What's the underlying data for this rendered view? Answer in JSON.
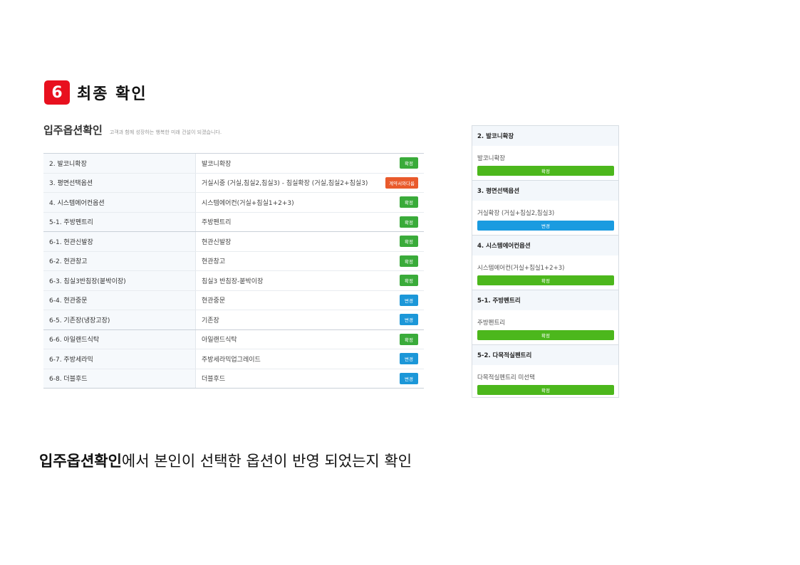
{
  "step": {
    "number": "6",
    "title": "최종 확인"
  },
  "option_panel": {
    "title": "입주옵션확인",
    "subtitle": "고객과 함께 성장하는 행복한 미래 건설이 되겠습니다.",
    "rows": [
      {
        "name": "2. 발코니확장",
        "value": "발코니확장",
        "status": "확정",
        "color": "green"
      },
      {
        "name": "3. 평면선택옵션",
        "value": "거실시중 (거실,침실2,침실3) - 침실확장 (거실,침실2+침실3)",
        "status": "계약서와다름",
        "color": "orange"
      },
      {
        "name": "4. 시스템에어컨옵션",
        "value": "시스템에어컨(거실+침실1+2+3)",
        "status": "확정",
        "color": "green"
      },
      {
        "name": "5-1. 주방펜트리",
        "value": "주방펜트리",
        "status": "확정",
        "color": "green"
      },
      {
        "name": "6-1. 현관신발장",
        "value": "현관신발장",
        "status": "확정",
        "color": "green"
      },
      {
        "name": "6-2. 현관창고",
        "value": "현관창고",
        "status": "확정",
        "color": "green"
      },
      {
        "name": "6-3. 침실3반침장(붙박이장)",
        "value": "침실3 반침장-붙박이장",
        "status": "확정",
        "color": "green"
      },
      {
        "name": "6-4. 현관중문",
        "value": "현관중문",
        "status": "변경",
        "color": "blue"
      },
      {
        "name": "6-5. 기존장(냉장고장)",
        "value": "기존장",
        "status": "변경",
        "color": "blue"
      },
      {
        "name": "6-6. 아일랜드식탁",
        "value": "아일랜드식탁",
        "status": "확정",
        "color": "green"
      },
      {
        "name": "6-7. 주방세라믹",
        "value": "주방세라믹업그레이드",
        "status": "변경",
        "color": "blue"
      },
      {
        "name": "6-8. 더블후드",
        "value": "더블후드",
        "status": "변경",
        "color": "blue"
      }
    ]
  },
  "mobile_panel": {
    "sections": [
      {
        "header": "2. 발코니확장",
        "value": "발코니확장",
        "button": "확정",
        "color": "green"
      },
      {
        "header": "3. 평면선택옵션",
        "value": "거실확장 (거실+침실2,침실3)",
        "button": "변경",
        "color": "blue"
      },
      {
        "header": "4. 시스템에어컨옵션",
        "value": "시스템에어컨(거실+침실1+2+3)",
        "button": "확정",
        "color": "green"
      },
      {
        "header": "5-1. 주방펜트리",
        "value": "주방펜트리",
        "button": "확정",
        "color": "green"
      },
      {
        "header": "5-2. 다목적실펜트리",
        "value": "다목적실펜트리 미선택",
        "button": "확정",
        "color": "green"
      }
    ]
  },
  "caption": {
    "bold": "입주옵션확인",
    "rest": "에서 본인이 선택한 옵션이 반영 되었는지 확인"
  },
  "colors": {
    "step_badge": "#e8101e",
    "badge_green": "#3aab3a",
    "badge_blue": "#1c97d8",
    "badge_orange": "#e95a2c"
  }
}
